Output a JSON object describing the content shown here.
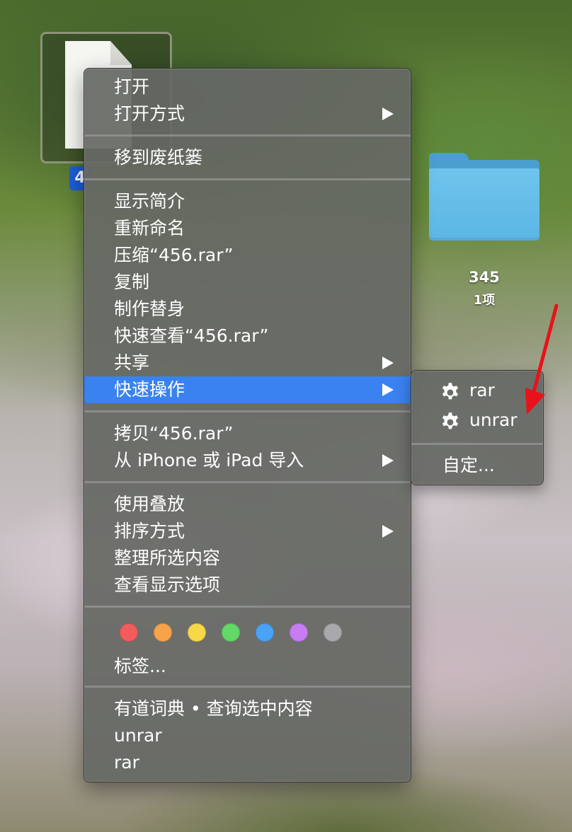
{
  "desktop": {
    "file_label_fragment": "4",
    "folder": {
      "name": "345",
      "count": "1项"
    }
  },
  "context_menu": {
    "items": [
      {
        "label": "打开"
      },
      {
        "label": "打开方式"
      },
      {
        "label": "移到废纸篓"
      },
      {
        "label": "显示简介"
      },
      {
        "label": "重新命名"
      },
      {
        "label": "压缩“456.rar”"
      },
      {
        "label": "复制"
      },
      {
        "label": "制作替身"
      },
      {
        "label": "快速查看“456.rar”"
      },
      {
        "label": "共享"
      },
      {
        "label": "快速操作"
      },
      {
        "label": "拷贝“456.rar”"
      },
      {
        "label": "从 iPhone 或 iPad 导入"
      },
      {
        "label": "使用叠放"
      },
      {
        "label": "排序方式"
      },
      {
        "label": "整理所选内容"
      },
      {
        "label": "查看显示选项"
      },
      {
        "label": "标签..."
      },
      {
        "label": "有道词典 • 查询选中内容"
      },
      {
        "label": "unrar"
      },
      {
        "label": "rar"
      }
    ],
    "highlighted": "快速操作",
    "tag_colors": [
      "#f25c5c",
      "#f7a34a",
      "#f7d84a",
      "#62d866",
      "#4aa3f7",
      "#c77cf2",
      "#a9a9ad"
    ]
  },
  "submenu": {
    "items": [
      {
        "label": "rar",
        "icon": "gear-icon"
      },
      {
        "label": "unrar",
        "icon": "gear-icon"
      },
      {
        "label": "自定..."
      }
    ]
  },
  "colors": {
    "highlight": "#3a82f0",
    "annotation_arrow": "#e8121a"
  }
}
